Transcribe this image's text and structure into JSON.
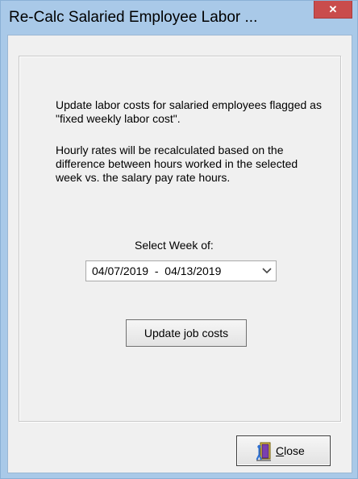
{
  "window": {
    "title": "Re-Calc Salaried Employee Labor ...",
    "close_glyph": "✕"
  },
  "dialog": {
    "description_1": "Update labor costs for salaried employees flagged as \"fixed weekly labor cost\".",
    "description_2": "Hourly rates will be recalculated based on the difference between hours worked in the selected week vs. the salary pay rate hours.",
    "select_label": "Select Week of:",
    "week_value": "04/07/2019  -  04/13/2019",
    "update_button": "Update job costs",
    "close_mnemonic": "C",
    "close_rest": "lose"
  },
  "icons": {
    "close_button_icon": "door-exit-icon",
    "dropdown_icon": "chevron-down-icon"
  },
  "colors": {
    "titlebar": "#a9c9e8",
    "close_button": "#c94c4c",
    "dialog_bg": "#f0f0f0"
  }
}
